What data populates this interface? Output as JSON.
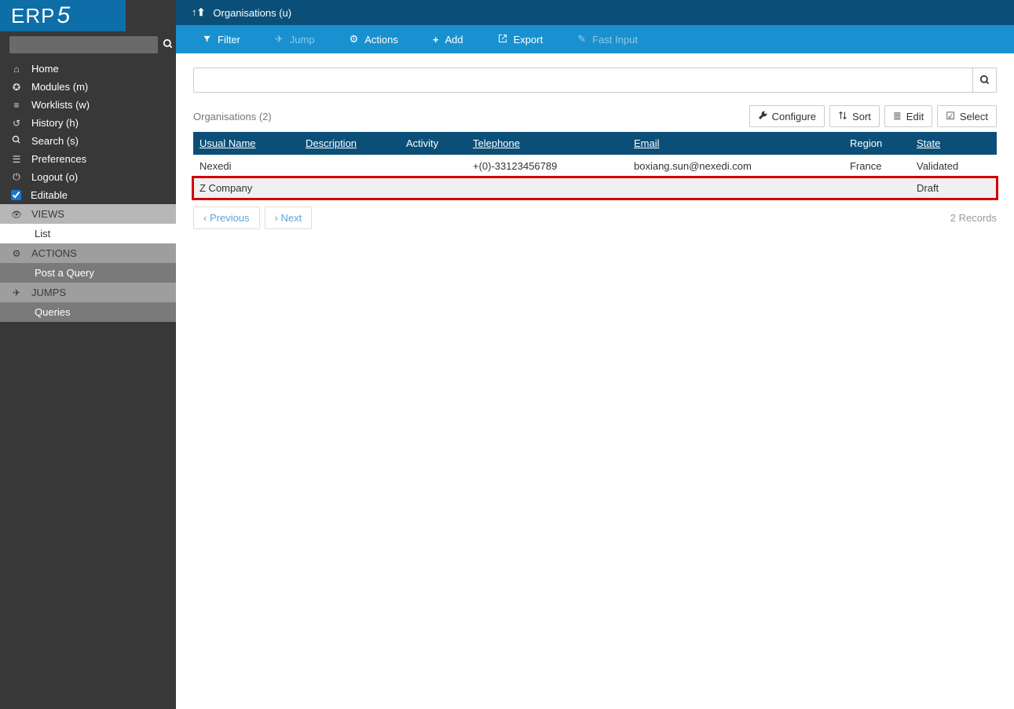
{
  "logo": {
    "text": "ERP",
    "suffix": "5"
  },
  "sidebar": {
    "search_placeholder": "",
    "items": [
      {
        "icon": "i-home",
        "label": "Home"
      },
      {
        "icon": "i-puzzle",
        "label": "Modules (m)"
      },
      {
        "icon": "i-list",
        "label": "Worklists (w)"
      },
      {
        "icon": "i-history",
        "label": "History (h)"
      },
      {
        "icon": "i-search",
        "label": "Search (s)"
      },
      {
        "icon": "i-sliders",
        "label": "Preferences"
      },
      {
        "icon": "i-power",
        "label": "Logout (o)"
      }
    ],
    "editable_label": "Editable",
    "editable_checked": true,
    "sections": {
      "views": {
        "label": "VIEWS",
        "items": [
          "List"
        ]
      },
      "actions": {
        "label": "ACTIONS",
        "items": [
          "Post a Query"
        ]
      },
      "jumps": {
        "label": "JUMPS",
        "items": [
          "Queries"
        ]
      }
    }
  },
  "breadcrumb": {
    "label": "Organisations (u)"
  },
  "toolbar": {
    "filter": "Filter",
    "jump": "Jump",
    "actions": "Actions",
    "add": "Add",
    "export": "Export",
    "fast_input": "Fast Input"
  },
  "listing": {
    "title": "Organisations (2)",
    "buttons": {
      "configure": "Configure",
      "sort": "Sort",
      "edit": "Edit",
      "select": "Select"
    },
    "columns": {
      "usual_name": "Usual Name",
      "description": "Description",
      "activity": "Activity",
      "telephone": "Telephone",
      "email": "Email",
      "region": "Region",
      "state": "State"
    },
    "rows": [
      {
        "usual_name": "Nexedi",
        "description": "",
        "activity": "",
        "telephone": "+(0)-33123456789",
        "email": "boxiang.sun@nexedi.com",
        "region": "France",
        "state": "Validated"
      },
      {
        "usual_name": "Z Company",
        "description": "",
        "activity": "",
        "telephone": "",
        "email": "",
        "region": "",
        "state": "Draft"
      }
    ],
    "pager": {
      "previous": "Previous",
      "next": "Next"
    },
    "records_label": "2 Records"
  }
}
